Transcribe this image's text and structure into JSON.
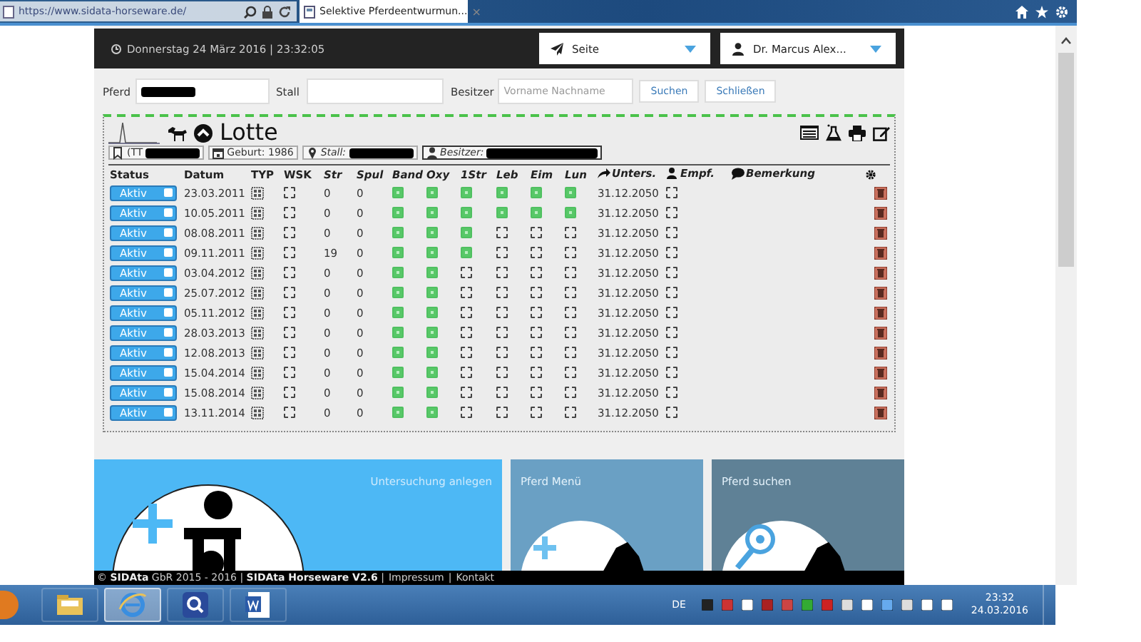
{
  "browser": {
    "address": "https://www.sidata-horseware.de/",
    "tab_title": "Selektive Pferdeentwurmun...",
    "tab_close": "×"
  },
  "header": {
    "datetime": "Donnerstag 24 März 2016 | 23:32:05",
    "page_select": "Seite",
    "user_select": "Dr. Marcus Alex..."
  },
  "search": {
    "horse_label": "Pferd",
    "stable_label": "Stall",
    "owner_label": "Besitzer",
    "owner_placeholder": "Vorname Nachname",
    "buttons": [
      "Suchen",
      "Schließen"
    ]
  },
  "horse": {
    "name": "Lotte",
    "chips": [
      {
        "kind": "tag",
        "text": "(TT"
      },
      {
        "kind": "birth",
        "text": "Geburt: 1986"
      },
      {
        "kind": "stable",
        "text": "Stall:"
      },
      {
        "kind": "owner",
        "text": "Besitzer:"
      }
    ]
  },
  "table": {
    "columns": [
      {
        "label": "Status",
        "italic": false
      },
      {
        "label": "Datum",
        "italic": false
      },
      {
        "label": "TYP",
        "italic": false
      },
      {
        "label": "WSK",
        "italic": false
      },
      {
        "label": "Str",
        "italic": true
      },
      {
        "label": "Spul",
        "italic": true
      },
      {
        "label": "Band",
        "italic": true
      },
      {
        "label": "Oxy",
        "italic": true
      },
      {
        "label": "1Str",
        "italic": true
      },
      {
        "label": "Leb",
        "italic": true
      },
      {
        "label": "Eim",
        "italic": true
      },
      {
        "label": "Lun",
        "italic": true
      },
      {
        "label": "Unters.",
        "italic": true
      },
      {
        "label": "Empf.",
        "italic": true
      },
      {
        "label": "Bemerkung",
        "italic": true
      }
    ],
    "rows": [
      {
        "status": "Aktiv",
        "date": "23.03.2011",
        "wsk": false,
        "str": "0",
        "spul": "0",
        "checks": [
          true,
          true,
          true,
          true,
          true,
          true
        ],
        "unters": "31.12.2050",
        "empf": false
      },
      {
        "status": "Aktiv",
        "date": "10.05.2011",
        "wsk": false,
        "str": "0",
        "spul": "0",
        "checks": [
          true,
          true,
          true,
          true,
          true,
          true
        ],
        "unters": "31.12.2050",
        "empf": false
      },
      {
        "status": "Aktiv",
        "date": "08.08.2011",
        "wsk": false,
        "str": "0",
        "spul": "0",
        "checks": [
          true,
          true,
          true,
          false,
          false,
          false
        ],
        "unters": "31.12.2050",
        "empf": false
      },
      {
        "status": "Aktiv",
        "date": "09.11.2011",
        "wsk": false,
        "str": "19",
        "spul": "0",
        "checks": [
          true,
          true,
          true,
          false,
          false,
          false
        ],
        "unters": "31.12.2050",
        "empf": false
      },
      {
        "status": "Aktiv",
        "date": "03.04.2012",
        "wsk": false,
        "str": "0",
        "spul": "0",
        "checks": [
          true,
          true,
          false,
          false,
          false,
          false
        ],
        "unters": "31.12.2050",
        "empf": false
      },
      {
        "status": "Aktiv",
        "date": "25.07.2012",
        "wsk": false,
        "str": "0",
        "spul": "0",
        "checks": [
          true,
          true,
          false,
          false,
          false,
          false
        ],
        "unters": "31.12.2050",
        "empf": false
      },
      {
        "status": "Aktiv",
        "date": "05.11.2012",
        "wsk": false,
        "str": "0",
        "spul": "0",
        "checks": [
          true,
          true,
          false,
          false,
          false,
          false
        ],
        "unters": "31.12.2050",
        "empf": false
      },
      {
        "status": "Aktiv",
        "date": "28.03.2013",
        "wsk": false,
        "str": "0",
        "spul": "0",
        "checks": [
          true,
          true,
          false,
          false,
          false,
          false
        ],
        "unters": "31.12.2050",
        "empf": false
      },
      {
        "status": "Aktiv",
        "date": "12.08.2013",
        "wsk": false,
        "str": "0",
        "spul": "0",
        "checks": [
          true,
          true,
          false,
          false,
          false,
          false
        ],
        "unters": "31.12.2050",
        "empf": false
      },
      {
        "status": "Aktiv",
        "date": "15.04.2014",
        "wsk": false,
        "str": "0",
        "spul": "0",
        "checks": [
          true,
          true,
          false,
          false,
          false,
          false
        ],
        "unters": "31.12.2050",
        "empf": false
      },
      {
        "status": "Aktiv",
        "date": "15.08.2014",
        "wsk": false,
        "str": "0",
        "spul": "0",
        "checks": [
          true,
          true,
          false,
          false,
          false,
          false
        ],
        "unters": "31.12.2050",
        "empf": false
      },
      {
        "status": "Aktiv",
        "date": "13.11.2014",
        "wsk": false,
        "str": "0",
        "spul": "0",
        "checks": [
          true,
          true,
          false,
          false,
          false,
          false
        ],
        "unters": "31.12.2050",
        "empf": false
      }
    ]
  },
  "tiles": [
    {
      "kind": "exam",
      "title": "Untersuchung anlegen"
    },
    {
      "kind": "menu",
      "title": "Pferd Menü"
    },
    {
      "kind": "find",
      "title": "Pferd suchen"
    }
  ],
  "footer": {
    "text": "© **SIDAta** GbR 2015 - 2016 | **SIDAta Horseware V2.6** |",
    "links": [
      "Impressum",
      "Kontakt"
    ],
    "separator": "|"
  },
  "taskbar": {
    "language": "DE",
    "time": "23:32",
    "date": "24.03.2016",
    "apps": [
      {
        "kind": "folder",
        "selected": false
      },
      {
        "kind": "browser",
        "selected": true
      },
      {
        "kind": "search",
        "selected": false
      },
      {
        "kind": "word",
        "selected": false
      }
    ]
  }
}
